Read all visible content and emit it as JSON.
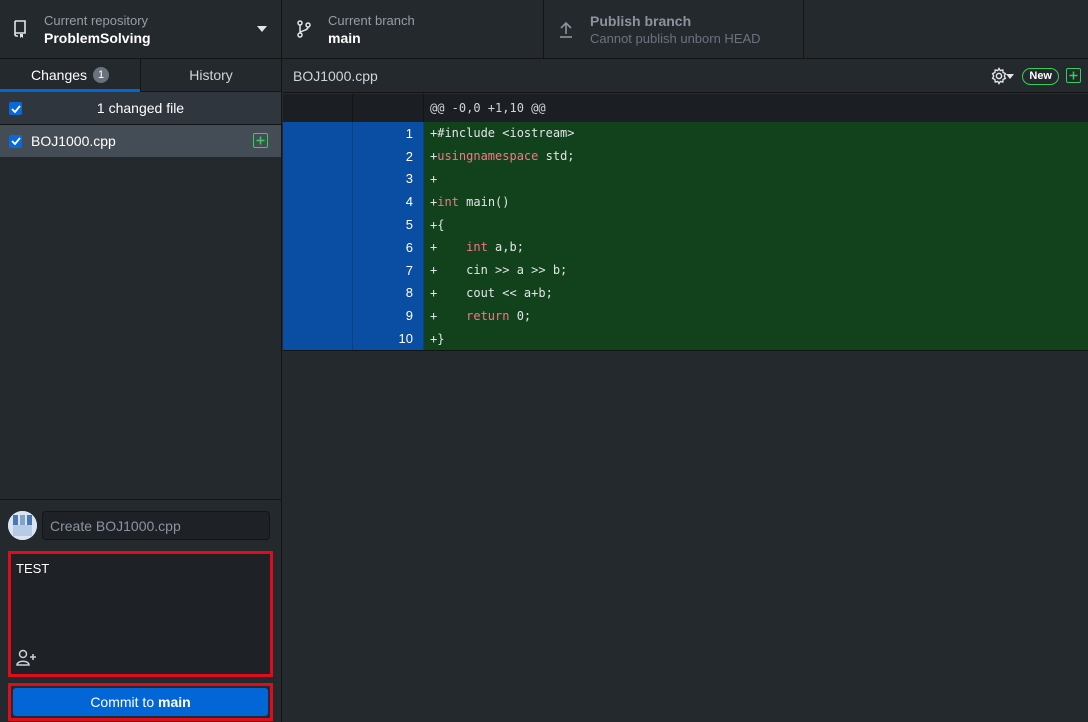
{
  "toolbar": {
    "repo_label": "Current repository",
    "repo_name": "ProblemSolving",
    "branch_label": "Current branch",
    "branch_name": "main",
    "publish_title": "Publish branch",
    "publish_subtitle": "Cannot publish unborn HEAD"
  },
  "tabs": {
    "changes_label": "Changes",
    "changes_count": "1",
    "history_label": "History"
  },
  "changes": {
    "summary": "1 changed file",
    "files": [
      {
        "name": "BOJ1000.cpp",
        "status": "added",
        "checked": true
      }
    ]
  },
  "commit": {
    "summary_placeholder": "Create BOJ1000.cpp",
    "description": "TEST",
    "button_prefix": "Commit to ",
    "button_branch": "main"
  },
  "diff": {
    "file_name": "BOJ1000.cpp",
    "new_badge": "New",
    "hunk_header": "@@ -0,0 +1,10 @@",
    "lines": [
      {
        "num": "1",
        "text": "+#include <iostream>"
      },
      {
        "num": "2",
        "text": "+using namespace std;"
      },
      {
        "num": "3",
        "text": "+"
      },
      {
        "num": "4",
        "text": "+int main()"
      },
      {
        "num": "5",
        "text": "+{"
      },
      {
        "num": "6",
        "text": "+    int a,b;"
      },
      {
        "num": "7",
        "text": "+    cin >> a >> b;"
      },
      {
        "num": "8",
        "text": "+    cout << a+b;"
      },
      {
        "num": "9",
        "text": "+    return 0;"
      },
      {
        "num": "10",
        "text": "+}"
      }
    ]
  },
  "colors": {
    "accent": "#0366d6",
    "added_green": "#34d058",
    "highlight_red": "#e00b1c"
  },
  "icons": {
    "repo": "repo-icon",
    "branch": "git-branch-icon",
    "publish": "upload-arrow-icon",
    "gear": "gear-icon",
    "coauthor": "person-add-icon"
  }
}
